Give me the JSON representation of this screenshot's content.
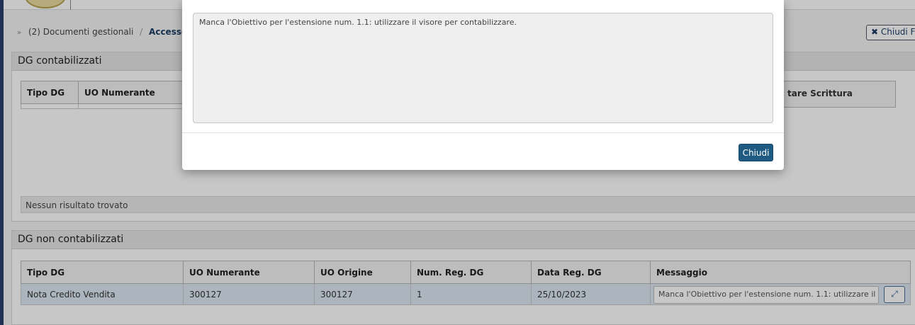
{
  "breadcrumb": {
    "parent": "(2) Documenti gestionali",
    "separator": "/",
    "current": "Accesso p"
  },
  "header": {
    "close_filter_label": "✖ Chiudi F"
  },
  "panel_contabilizzati": {
    "title": "DG contabilizzati",
    "columns": [
      "Tipo DG",
      "UO Numerante"
    ],
    "right_column": "tare Scrittura",
    "empty_text": "Nessun risultato trovato"
  },
  "panel_non_contabilizzati": {
    "title": "DG non contabilizzati",
    "columns": [
      "Tipo DG",
      "UO Numerante",
      "UO Origine",
      "Num. Reg. DG",
      "Data Reg. DG",
      "Messaggio"
    ],
    "rows": [
      {
        "tipo": "Nota Credito Vendita",
        "uo_numerante": "300127",
        "uo_origine": "300127",
        "num_reg": "1",
        "data_reg": "25/10/2023",
        "messaggio": "Manca l'Obiettivo per l'estensione num. 1.1: utilizzare il"
      }
    ]
  },
  "modal": {
    "message": "Manca l'Obiettivo per l'estensione num. 1.1: utilizzare il visore per contabilizzare.",
    "close_label": "Chiudi"
  },
  "icons": {
    "expand": "expand-icon",
    "breadcrumb_arrow": "arrow-right-icon"
  }
}
